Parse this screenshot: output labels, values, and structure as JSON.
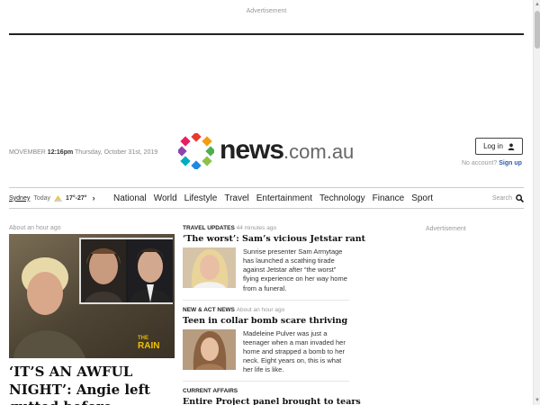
{
  "advertisement_label": "Advertisement",
  "masthead": {
    "date_prefix": "MOVEMBER",
    "time": "12:16pm",
    "date": "Thursday, October 31st, 2019",
    "logo_word": "news",
    "logo_domain": ".com.au"
  },
  "account": {
    "login_label": "Log in",
    "no_account_text": "No account?",
    "signup_label": "Sign up"
  },
  "weather": {
    "city": "Sydney",
    "day": "Today",
    "temps": "17°-27°",
    "icon": "partly-sunny-icon"
  },
  "nav": {
    "items": [
      "National",
      "World",
      "Lifestyle",
      "Travel",
      "Entertainment",
      "Technology",
      "Finance",
      "Sport"
    ],
    "search_label": "Search"
  },
  "lead_story": {
    "time": "About an hour ago",
    "headline": "‘IT’S AN AWFUL NIGHT’: Angie left gutted before",
    "image_brand_top": "THE",
    "image_brand_main": "RAIN"
  },
  "stories": [
    {
      "category": "TRAVEL UPDATES",
      "time": "44 minutes ago",
      "title": "‘The worst’: Sam’s vicious Jetstar rant",
      "summary": "Sunrise presenter Sam Armytage has launched a scathing tirade against Jetstar after “the worst” flying experience on her way home from a funeral."
    },
    {
      "category": "NEW & ACT NEWS",
      "time": "About an hour ago",
      "title": "Teen in collar bomb scare thriving",
      "summary": "Madeleine Pulver was just a teenager when a man invaded her home and strapped a bomb to her neck. Eight years on, this is what her life is like."
    },
    {
      "category": "CURRENT AFFAIRS",
      "time": "",
      "title": "Entire Project panel brought to tears",
      "summary": ""
    }
  ],
  "colors": {
    "link_blue": "#2a5db0",
    "logo_dot_red": "#e63b2e",
    "logo_dot_orange": "#f39c12",
    "logo_dot_green": "#4caf50",
    "logo_dot_blue": "#1e88e5",
    "logo_dot_teal": "#00acc1",
    "logo_dot_purple": "#8e44ad",
    "logo_dot_pink": "#e91e63",
    "logo_dot_lime": "#8bc34a"
  }
}
